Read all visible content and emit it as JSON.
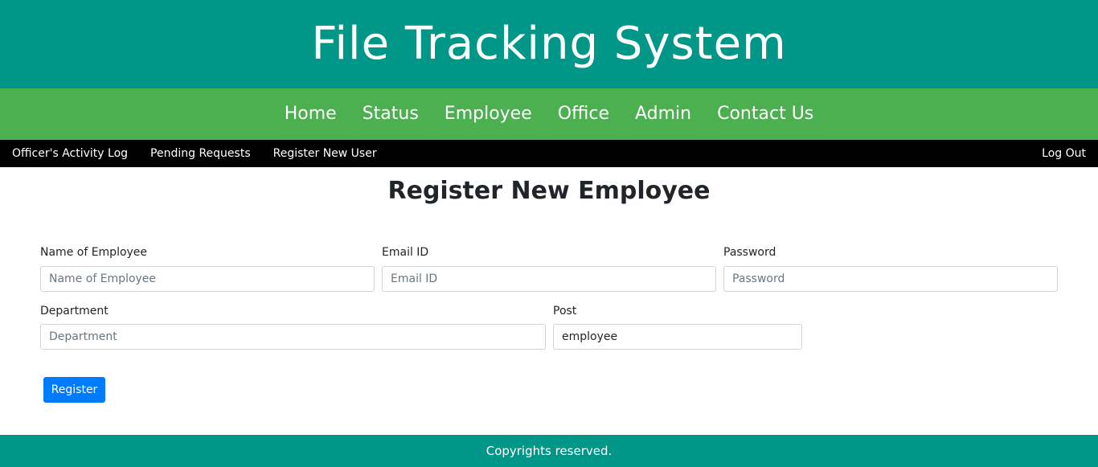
{
  "header": {
    "title": "File Tracking System"
  },
  "main_nav": {
    "items": [
      "Home",
      "Status",
      "Employee",
      "Office",
      "Admin",
      "Contact Us"
    ]
  },
  "sub_nav": {
    "items": [
      "Officer's Activity Log",
      "Pending Requests",
      "Register New User"
    ],
    "logout": "Log Out"
  },
  "page": {
    "title": "Register New Employee"
  },
  "form": {
    "name": {
      "label": "Name of Employee",
      "placeholder": "Name of Employee",
      "value": ""
    },
    "email": {
      "label": "Email ID",
      "placeholder": "Email ID",
      "value": ""
    },
    "password": {
      "label": "Password",
      "placeholder": "Password",
      "value": ""
    },
    "department": {
      "label": "Department",
      "placeholder": "Department",
      "value": ""
    },
    "post": {
      "label": "Post",
      "placeholder": "",
      "value": "employee"
    },
    "submit_label": "Register"
  },
  "footer": {
    "text": "Copyrights reserved."
  },
  "colors": {
    "banner": "#009688",
    "main_nav": "#4caf50",
    "sub_nav": "#000000",
    "primary_button": "#007bff",
    "footer": "#009688"
  }
}
